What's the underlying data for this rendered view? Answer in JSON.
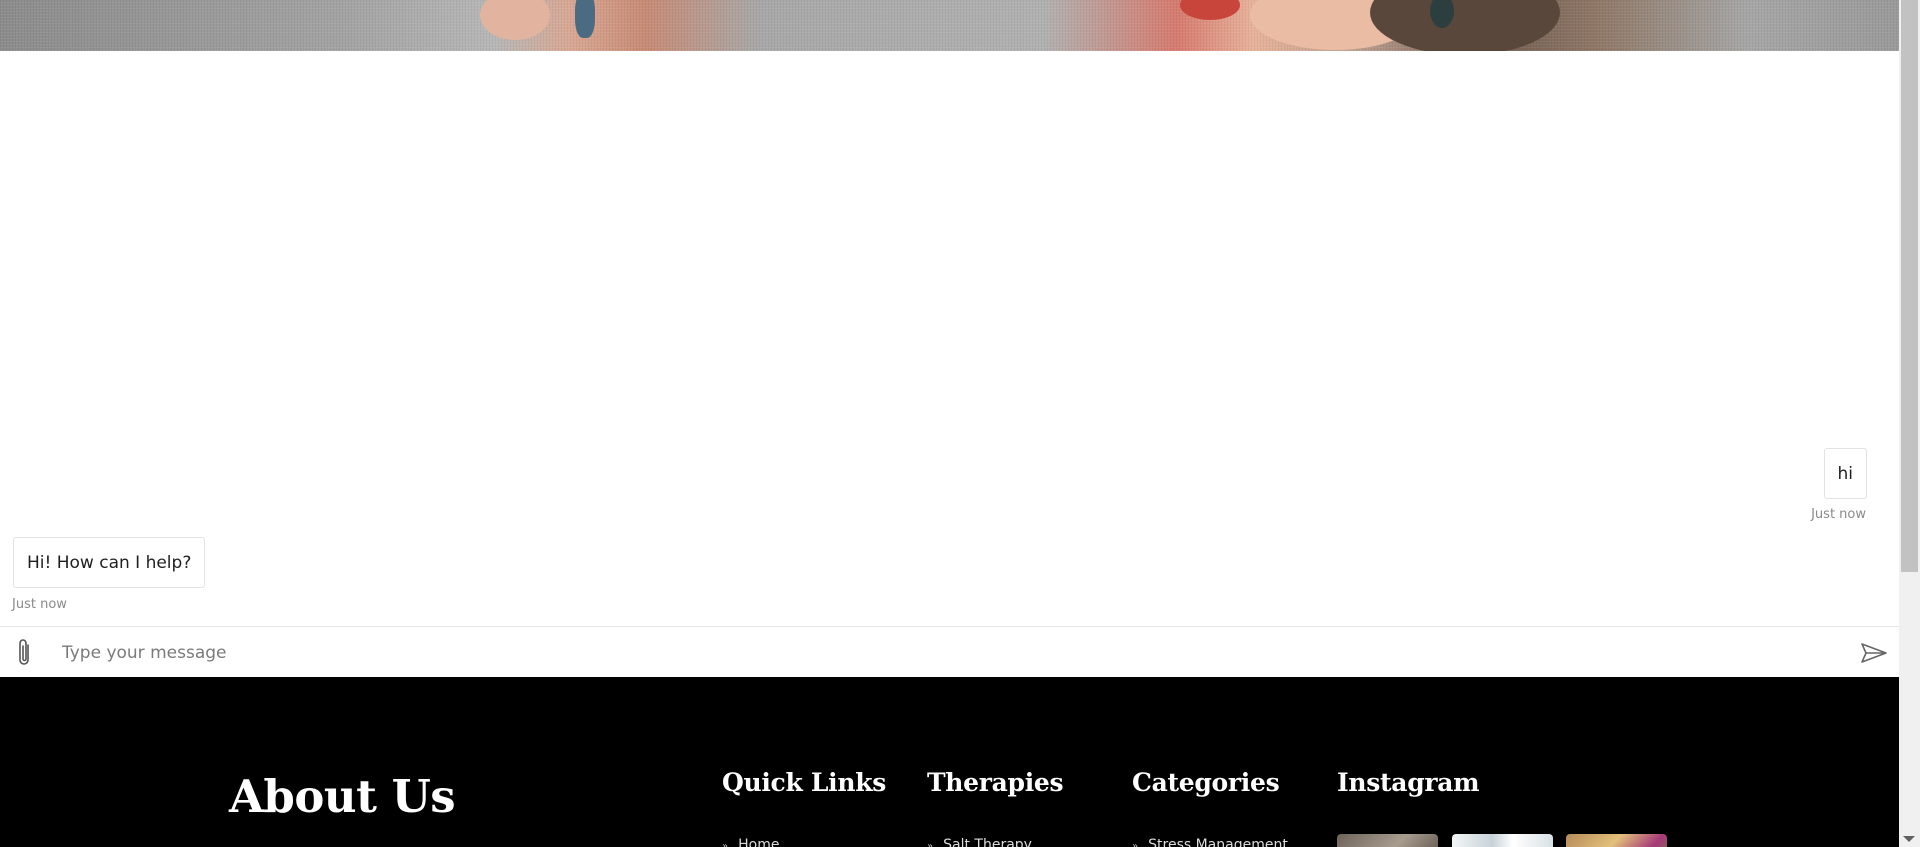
{
  "chat": {
    "messages": [
      {
        "sender": "user",
        "text": "hi",
        "time": "Just now"
      },
      {
        "sender": "bot",
        "text": "Hi! How can I help?",
        "time": "Just now"
      }
    ],
    "composer": {
      "placeholder": "Type your message",
      "value": "",
      "attach_icon": "paperclip-icon",
      "send_icon": "send-icon"
    }
  },
  "footer": {
    "about_title": "About Us",
    "columns": [
      {
        "title": "Quick Links",
        "first_item": "Home"
      },
      {
        "title": "Therapies",
        "first_item": "Salt Therapy"
      },
      {
        "title": "Categories",
        "first_item": "Stress Management"
      },
      {
        "title": "Instagram"
      }
    ]
  },
  "colors": {
    "footer_bg": "#000000",
    "footer_text": "#ffffff",
    "bubble_border": "#e3e3e3",
    "timestamp": "#8a8a8a"
  }
}
